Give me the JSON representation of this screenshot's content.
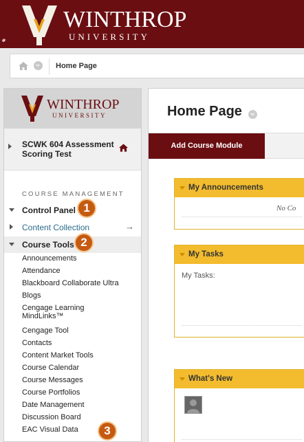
{
  "header": {
    "logo_word1": "WINTHROP",
    "logo_word2": "UNIVERSITY",
    "brand_color": "#6a0e12"
  },
  "breadcrumb": {
    "home_icon": "home-icon",
    "current": "Home Page"
  },
  "sidebar": {
    "logo_word1": "WINTHROP",
    "logo_word2": "UNIVERSITY",
    "course_name": "SCWK 604 Assessment Scoring Test",
    "course_management_heading": "COURSE MANAGEMENT",
    "control_panel_label": "Control Panel",
    "content_collection_label": "Content Collection",
    "course_tools_label": "Course Tools",
    "tools": [
      "Announcements",
      "Attendance",
      "Blackboard Collaborate Ultra",
      "Blogs",
      "Cengage Learning MindLinks™",
      "Cengage Tool",
      "Contacts",
      "Content Market Tools",
      "Course Calendar",
      "Course Messages",
      "Course Portfolios",
      "Date Management",
      "Discussion Board",
      "EAC Visual Data"
    ],
    "badges": [
      "1",
      "2",
      "3"
    ],
    "badge_color": "#c55a11"
  },
  "main": {
    "title": "Home Page",
    "add_module_label": "Add Course Module",
    "modules": [
      {
        "title": "My Announcements",
        "body": "No Co"
      },
      {
        "title": "My Tasks",
        "body": "My Tasks:"
      },
      {
        "title": "What's New",
        "body": ""
      }
    ],
    "module_header_color": "#f3bc2e"
  }
}
